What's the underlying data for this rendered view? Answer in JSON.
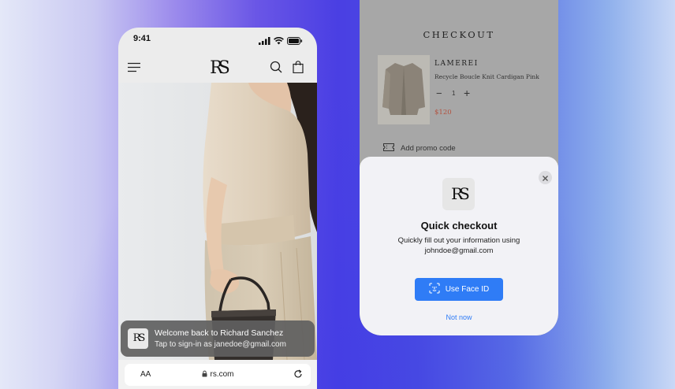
{
  "left_phone": {
    "status_time": "9:41",
    "logo_text": "RS",
    "toast": {
      "logo_text": "RS",
      "title": "Welcome back to Richard Sanchez",
      "subtitle": "Tap to sign-in as janedoe@gmail.com"
    },
    "url_bar": {
      "text_size_label": "AA",
      "url": "rs.com"
    }
  },
  "right_phone": {
    "checkout_title": "CHECKOUT",
    "product": {
      "brand": "LAMEREI",
      "name": "Recycle Boucle Knit Cardigan Pink",
      "quantity": "1",
      "minus": "−",
      "plus": "+",
      "price": "$120"
    },
    "promo_label": "Add promo code",
    "sheet": {
      "logo_text": "RS",
      "title": "Quick checkout",
      "description": "Quickly fill out your information using johndoe@gmail.com",
      "primary_button": "Use Face ID",
      "secondary_link": "Not now"
    }
  },
  "colors": {
    "accent_blue": "#2f7cf6",
    "price_red": "#b3523f",
    "toast_bg": "#5f5f5f"
  },
  "icons": [
    "menu-icon",
    "search-icon",
    "shopping-bag-icon",
    "signal-icon",
    "wifi-icon",
    "battery-icon",
    "lock-icon",
    "reload-icon",
    "ticket-icon",
    "close-icon",
    "face-id-icon"
  ]
}
